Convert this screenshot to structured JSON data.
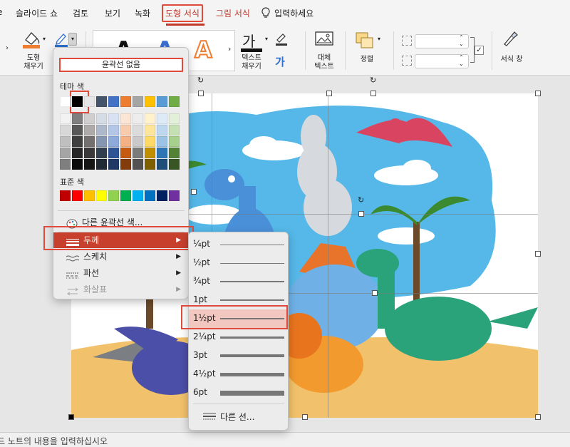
{
  "tabs": [
    "슬라이드 쇼",
    "검토",
    "보기",
    "녹화",
    "도형 서식",
    "그림 서식",
    "입력하세요"
  ],
  "ribbon": {
    "shape_fill": "도형\n채우기",
    "text_fill": "텍스트\n채우기",
    "alt_text": "대체\n텍스트",
    "arrange": "정렬",
    "format_pane": "서식 창",
    "thumb_glyph": "A",
    "ga_glyph": "가"
  },
  "outline_menu": {
    "no_outline": "윤곽선 없음",
    "theme_colors_label": "테마 색",
    "standard_colors_label": "표준 색",
    "theme_row": [
      "#ffffff",
      "#000000",
      "#e7e6e6",
      "#44546a",
      "#4472c4",
      "#ed7d31",
      "#a5a5a5",
      "#ffc000",
      "#5b9bd5",
      "#70ad47"
    ],
    "theme_shades": [
      [
        "#f2f2f2",
        "#7f7f7f",
        "#d0cece",
        "#d6dce4",
        "#d9e2f3",
        "#fbe5d5",
        "#ededed",
        "#fff2cc",
        "#deebf6",
        "#e2efd9"
      ],
      [
        "#d8d8d8",
        "#595959",
        "#aeaaaa",
        "#adb9ca",
        "#b4c6e7",
        "#f7cbac",
        "#dbdbdb",
        "#fee599",
        "#bdd7ee",
        "#c5e0b3"
      ],
      [
        "#bfbfbf",
        "#3f3f3f",
        "#757070",
        "#8496b0",
        "#8eaadb",
        "#f4b183",
        "#c9c9c9",
        "#ffd965",
        "#9cc3e5",
        "#a8d08d"
      ],
      [
        "#a5a5a5",
        "#262626",
        "#3a3838",
        "#323f4f",
        "#2f5496",
        "#c55a11",
        "#7b7b7b",
        "#bf8f00",
        "#2e75b5",
        "#538135"
      ],
      [
        "#7f7f7f",
        "#0c0c0c",
        "#171616",
        "#222a35",
        "#1f3864",
        "#833c0b",
        "#525252",
        "#7f6000",
        "#1e4e79",
        "#375623"
      ]
    ],
    "standard_row": [
      "#c00000",
      "#ff0000",
      "#ffc000",
      "#ffff00",
      "#92d050",
      "#00b050",
      "#00b0f0",
      "#0070c0",
      "#002060",
      "#7030a0"
    ],
    "more_colors": "다른 윤곽선 색...",
    "weight": "두께",
    "sketch": "스케치",
    "dash": "파선",
    "arrows": "화살표"
  },
  "weight_menu": {
    "items": [
      "¼pt",
      "½pt",
      "¾pt",
      "1pt",
      "1½pt",
      "2¼pt",
      "3pt",
      "4½pt",
      "6pt"
    ],
    "selected": "1½pt",
    "more_lines": "다른 선..."
  },
  "status": {
    "notes_hint": "노트의 내용을 입력하십시오"
  }
}
